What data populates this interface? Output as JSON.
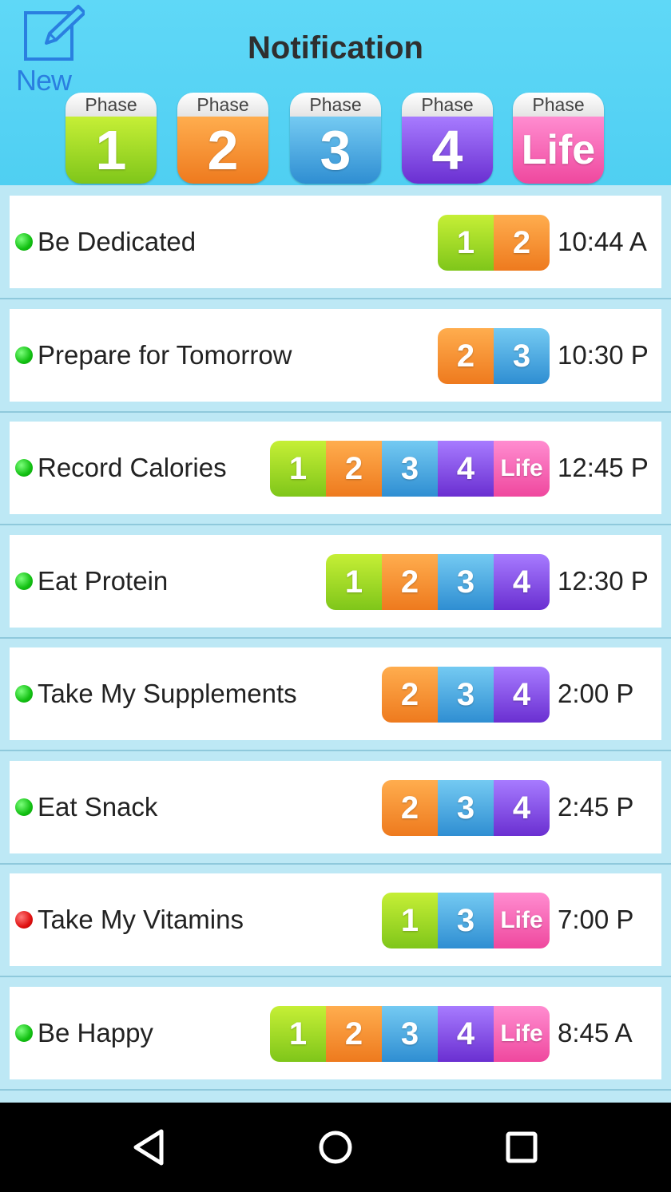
{
  "header": {
    "title": "Notification",
    "new_label": "New",
    "phases": [
      {
        "top": "Phase",
        "value": "1",
        "color": "#8fd11f"
      },
      {
        "top": "Phase",
        "value": "2",
        "color": "#f28a2a"
      },
      {
        "top": "Phase",
        "value": "3",
        "color": "#3d9fdc"
      },
      {
        "top": "Phase",
        "value": "4",
        "color": "#7a3ee0"
      },
      {
        "top": "Phase",
        "value": "Life",
        "color": "#f25aa8"
      }
    ]
  },
  "notifications": [
    {
      "label": "Be Dedicated",
      "status": "green",
      "phases": [
        "1",
        "2"
      ],
      "time": "10:44 A"
    },
    {
      "label": "Prepare for Tomorrow",
      "status": "green",
      "phases": [
        "2",
        "3"
      ],
      "time": "10:30 P"
    },
    {
      "label": "Record Calories",
      "status": "green",
      "phases": [
        "1",
        "2",
        "3",
        "4",
        "Life"
      ],
      "time": "12:45 P"
    },
    {
      "label": "Eat Protein",
      "status": "green",
      "phases": [
        "1",
        "2",
        "3",
        "4"
      ],
      "time": "12:30 P"
    },
    {
      "label": "Take My Supplements",
      "status": "green",
      "phases": [
        "2",
        "3",
        "4"
      ],
      "time": "2:00 P"
    },
    {
      "label": "Eat Snack",
      "status": "green",
      "phases": [
        "2",
        "3",
        "4"
      ],
      "time": "2:45 P"
    },
    {
      "label": "Take My Vitamins",
      "status": "red",
      "phases": [
        "1",
        "3",
        "Life"
      ],
      "time": "7:00 P"
    },
    {
      "label": "Be Happy",
      "status": "green",
      "phases": [
        "1",
        "2",
        "3",
        "4",
        "Life"
      ],
      "time": "8:45 A"
    }
  ],
  "navbar": {
    "icons": [
      "back-icon",
      "home-icon",
      "recents-icon"
    ]
  }
}
